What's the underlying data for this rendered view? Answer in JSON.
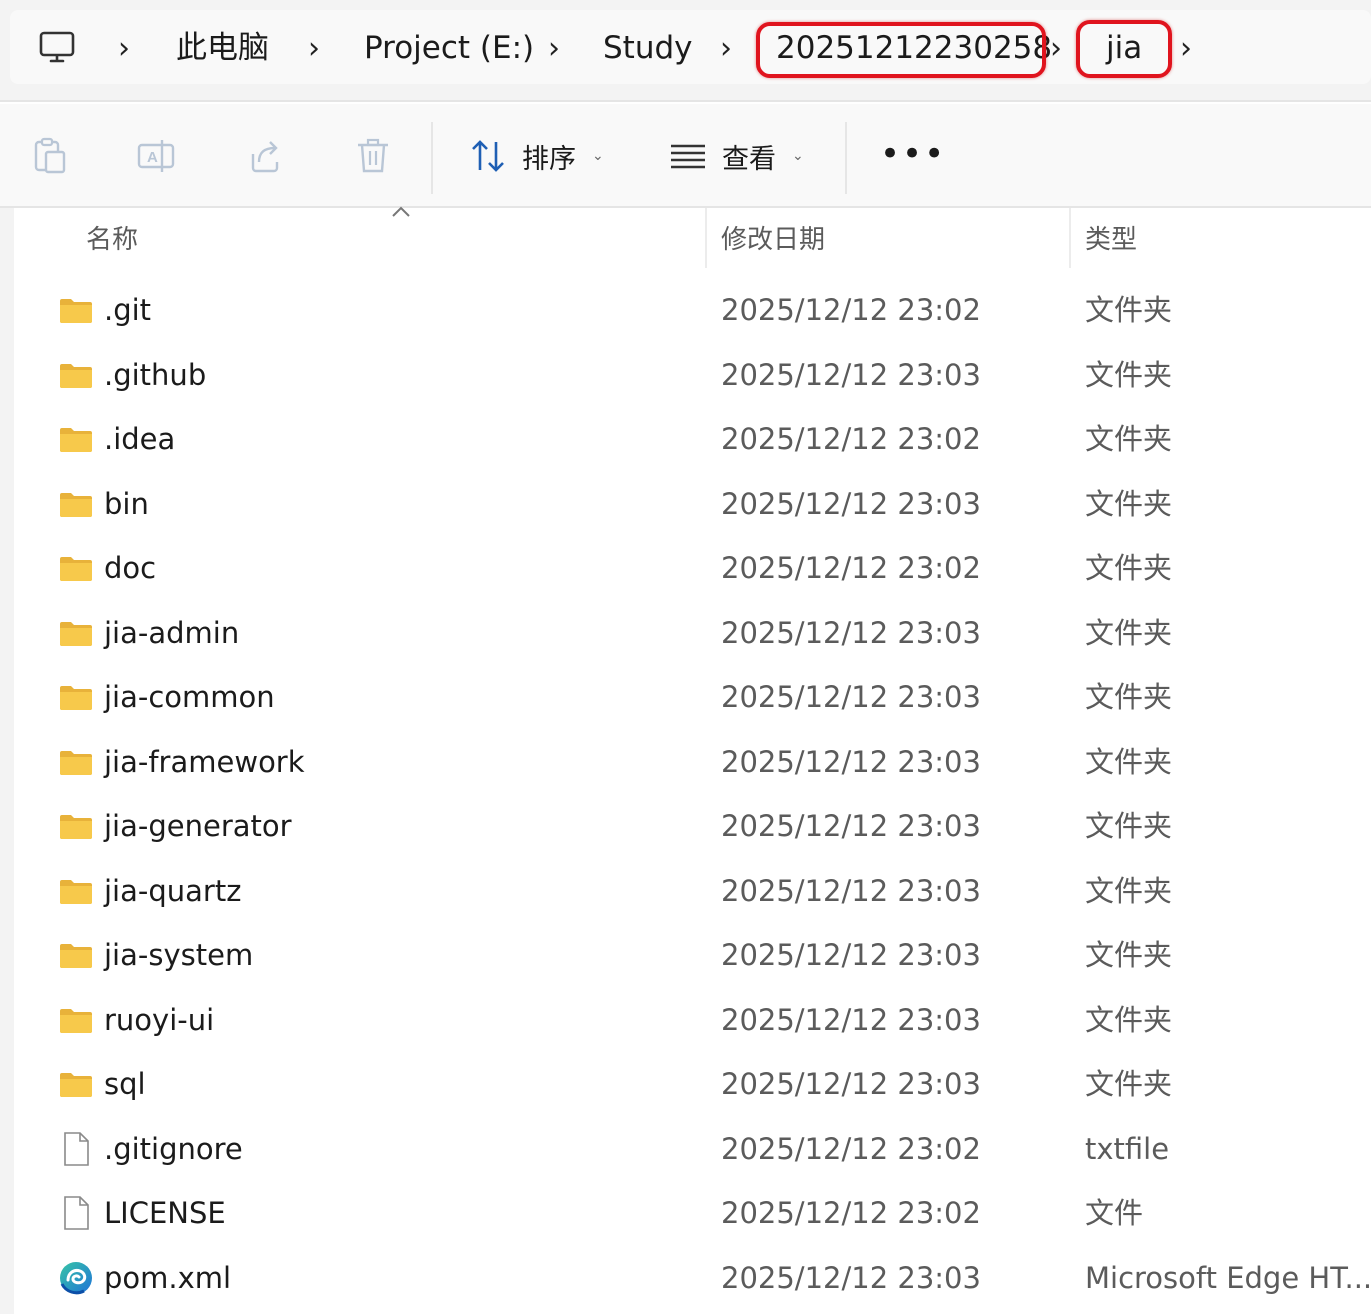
{
  "breadcrumb": {
    "items": [
      "此电脑",
      "Project (E:)",
      "Study",
      "20251212230258",
      "jia"
    ]
  },
  "toolbar": {
    "sort_label": "排序",
    "view_label": "查看"
  },
  "columns": {
    "name": "名称",
    "date": "修改日期",
    "type": "类型"
  },
  "files": [
    {
      "name": ".git",
      "date": "2025/12/12 23:02",
      "type": "文件夹",
      "icon": "folder-icon"
    },
    {
      "name": ".github",
      "date": "2025/12/12 23:03",
      "type": "文件夹",
      "icon": "folder-icon"
    },
    {
      "name": ".idea",
      "date": "2025/12/12 23:02",
      "type": "文件夹",
      "icon": "folder-icon"
    },
    {
      "name": "bin",
      "date": "2025/12/12 23:03",
      "type": "文件夹",
      "icon": "folder-icon"
    },
    {
      "name": "doc",
      "date": "2025/12/12 23:02",
      "type": "文件夹",
      "icon": "folder-icon"
    },
    {
      "name": "jia-admin",
      "date": "2025/12/12 23:03",
      "type": "文件夹",
      "icon": "folder-icon"
    },
    {
      "name": "jia-common",
      "date": "2025/12/12 23:03",
      "type": "文件夹",
      "icon": "folder-icon"
    },
    {
      "name": "jia-framework",
      "date": "2025/12/12 23:03",
      "type": "文件夹",
      "icon": "folder-icon"
    },
    {
      "name": "jia-generator",
      "date": "2025/12/12 23:03",
      "type": "文件夹",
      "icon": "folder-icon"
    },
    {
      "name": "jia-quartz",
      "date": "2025/12/12 23:03",
      "type": "文件夹",
      "icon": "folder-icon"
    },
    {
      "name": "jia-system",
      "date": "2025/12/12 23:03",
      "type": "文件夹",
      "icon": "folder-icon"
    },
    {
      "name": "ruoyi-ui",
      "date": "2025/12/12 23:03",
      "type": "文件夹",
      "icon": "folder-icon"
    },
    {
      "name": "sql",
      "date": "2025/12/12 23:03",
      "type": "文件夹",
      "icon": "folder-icon"
    },
    {
      "name": ".gitignore",
      "date": "2025/12/12 23:02",
      "type": "txtfile",
      "icon": "file-icon"
    },
    {
      "name": "LICENSE",
      "date": "2025/12/12 23:02",
      "type": "文件",
      "icon": "file-icon"
    },
    {
      "name": "pom.xml",
      "date": "2025/12/12 23:03",
      "type": "Microsoft Edge HT...",
      "icon": "edge-icon"
    }
  ],
  "colors": {
    "highlight": "#e0141e",
    "folder": "#f7c94b"
  }
}
